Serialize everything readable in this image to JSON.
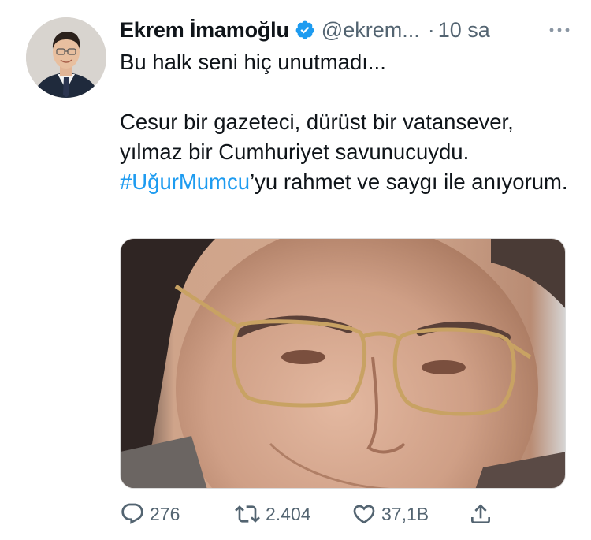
{
  "tweet": {
    "author": {
      "name": "Ekrem İmamoğlu",
      "handle": "@ekrem...",
      "separator": "·",
      "time": "10 sa",
      "verified": true
    },
    "text": {
      "line1": "Bu halk seni hiç unutmadı...",
      "line2": "Cesur bir gazeteci, dürüst bir vatansever, yılmaz bir Cumhuriyet savunucuydu.",
      "hashtag": "#UğurMumcu",
      "line3_rest": "’yu rahmet ve saygı ile anıyorum."
    },
    "actions": {
      "reply_count": "276",
      "retweet_count": "2.404",
      "like_count": "37,1B"
    }
  },
  "icons": {
    "verified": "verified-badge-icon",
    "more": "more-options-icon",
    "reply": "reply-icon",
    "retweet": "retweet-icon",
    "like": "heart-icon",
    "share": "share-icon"
  },
  "colors": {
    "accent": "#1d9bf0",
    "text_primary": "#0f1419",
    "text_secondary": "#536471"
  }
}
